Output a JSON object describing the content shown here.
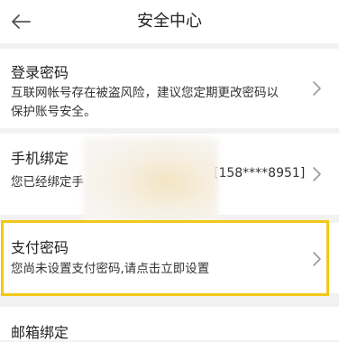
{
  "header": {
    "title": "安全中心",
    "back_icon": "arrow-left-icon"
  },
  "rows": [
    {
      "title": "登录密码",
      "description": "互联网帐号存在被盗风险，建议您定期更改密码以保护账号安全。",
      "description_lines": [
        "互联网帐号存在被盗风险，建议您定期更改密码以",
        "保护账号安全。"
      ]
    },
    {
      "title": "手机绑定",
      "description": "您已经绑定手",
      "phone": "[158****8951]"
    },
    {
      "title": "支付密码",
      "description": "您尚未设置支付密码,请点击立即设置"
    },
    {
      "title": "邮箱绑定"
    }
  ],
  "colors": {
    "highlight": "#f2c818",
    "background": "#f2f2f2",
    "card": "#ffffff",
    "chevron": "#9a9a9a"
  },
  "icons": {
    "chevron": "chevron-right-icon"
  }
}
